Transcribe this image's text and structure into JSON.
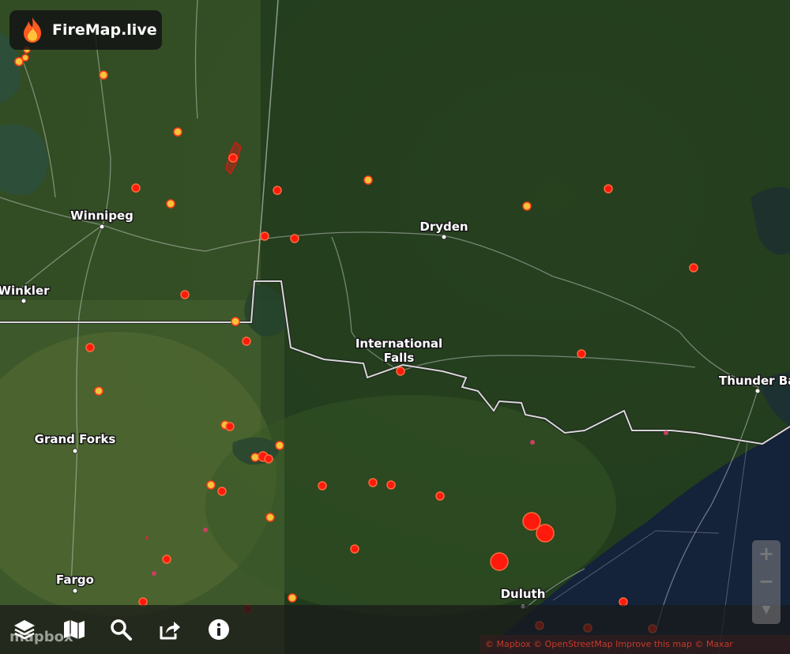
{
  "app": {
    "brand": "FireMap.live"
  },
  "map": {
    "cities": [
      {
        "name": "Winnipeg"
      },
      {
        "name": "Winkler"
      },
      {
        "name": "Dryden"
      },
      {
        "name": "International"
      },
      {
        "name": "Falls"
      },
      {
        "name": "Thunder Ba"
      },
      {
        "name": "Grand Forks"
      },
      {
        "name": "Fargo"
      },
      {
        "name": "Duluth"
      }
    ]
  },
  "toolbar": {
    "layers_icon": "layers-icon",
    "map_icon": "map-icon",
    "search_icon": "search-icon",
    "share_icon": "share-icon",
    "info_icon": "info-icon"
  },
  "zoom": {
    "in_label": "+",
    "out_label": "−",
    "compass_label": "▼"
  },
  "mapbox_logo": "mapbox",
  "attribution": "© Mapbox © OpenStreetMap Improve this map © Maxar",
  "colors": {
    "fire_red": "#ff1a0d",
    "fire_yellow": "#f5c33b",
    "water": "#1a2a3f",
    "land": "#2e4a1f"
  }
}
